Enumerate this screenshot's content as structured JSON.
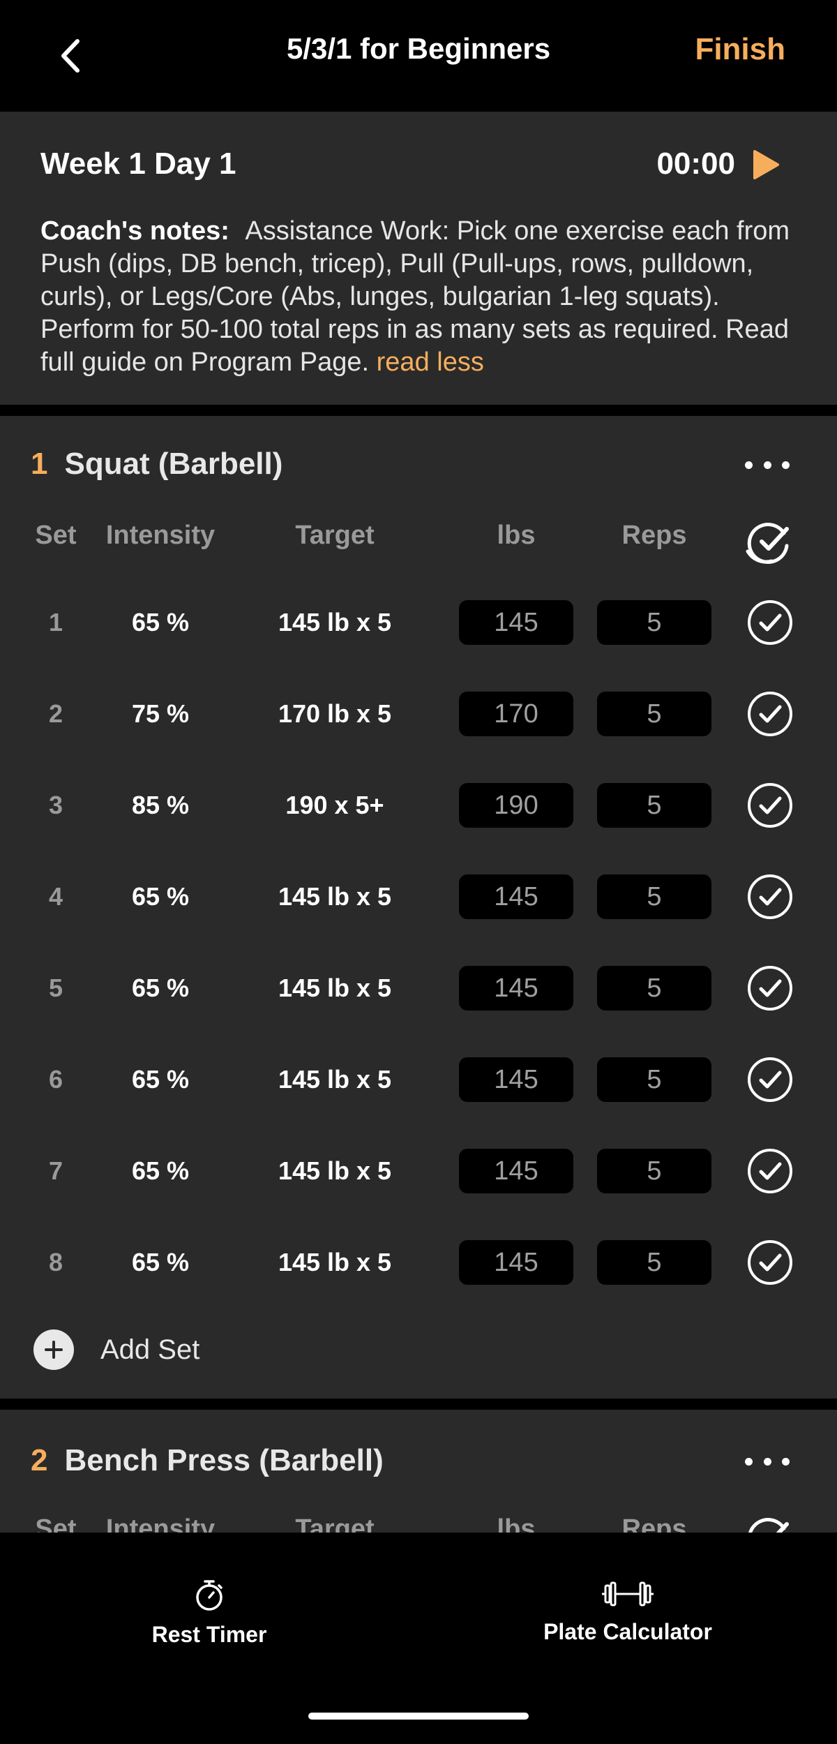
{
  "app": {
    "title": "5/3/1 for Beginners",
    "back_icon": "chevron-left-icon",
    "finish_label": "Finish",
    "accent_color": "#f6ae5d"
  },
  "workout": {
    "day_title": "Week 1 Day 1",
    "timer": "00:00",
    "play_icon": "play-icon",
    "notes_label": "Coach's notes:",
    "notes_text": "Assistance Work: Pick one exercise each from Push (dips, DB bench, tricep), Pull (Pull-ups, rows, pulldown, curls), or Legs/Core (Abs, lunges, bulgarian 1-leg squats). Perform for 50-100 total reps in as many sets as required. Read full guide on Program Page.",
    "notes_link": "read less"
  },
  "columns": {
    "set": "Set",
    "intensity": "Intensity",
    "target": "Target",
    "lbs": "lbs",
    "reps": "Reps"
  },
  "exercises": [
    {
      "number": "1",
      "name": "Squat (Barbell)",
      "add_set_label": "Add Set",
      "sets": [
        {
          "set": "1",
          "intensity": "65 %",
          "target": "145 lb x 5",
          "lbs": "145",
          "reps": "5"
        },
        {
          "set": "2",
          "intensity": "75 %",
          "target": "170 lb x 5",
          "lbs": "170",
          "reps": "5"
        },
        {
          "set": "3",
          "intensity": "85 %",
          "target": "190 x 5+",
          "lbs": "190",
          "reps": "5"
        },
        {
          "set": "4",
          "intensity": "65 %",
          "target": "145 lb x 5",
          "lbs": "145",
          "reps": "5"
        },
        {
          "set": "5",
          "intensity": "65 %",
          "target": "145 lb x 5",
          "lbs": "145",
          "reps": "5"
        },
        {
          "set": "6",
          "intensity": "65 %",
          "target": "145 lb x 5",
          "lbs": "145",
          "reps": "5"
        },
        {
          "set": "7",
          "intensity": "65 %",
          "target": "145 lb x 5",
          "lbs": "145",
          "reps": "5"
        },
        {
          "set": "8",
          "intensity": "65 %",
          "target": "145 lb x 5",
          "lbs": "145",
          "reps": "5"
        }
      ]
    },
    {
      "number": "2",
      "name": "Bench Press (Barbell)"
    }
  ],
  "bottom_bar": {
    "rest_timer_label": "Rest Timer",
    "rest_timer_icon": "stopwatch-icon",
    "plate_calc_label": "Plate Calculator",
    "plate_calc_icon": "barbell-icon"
  }
}
